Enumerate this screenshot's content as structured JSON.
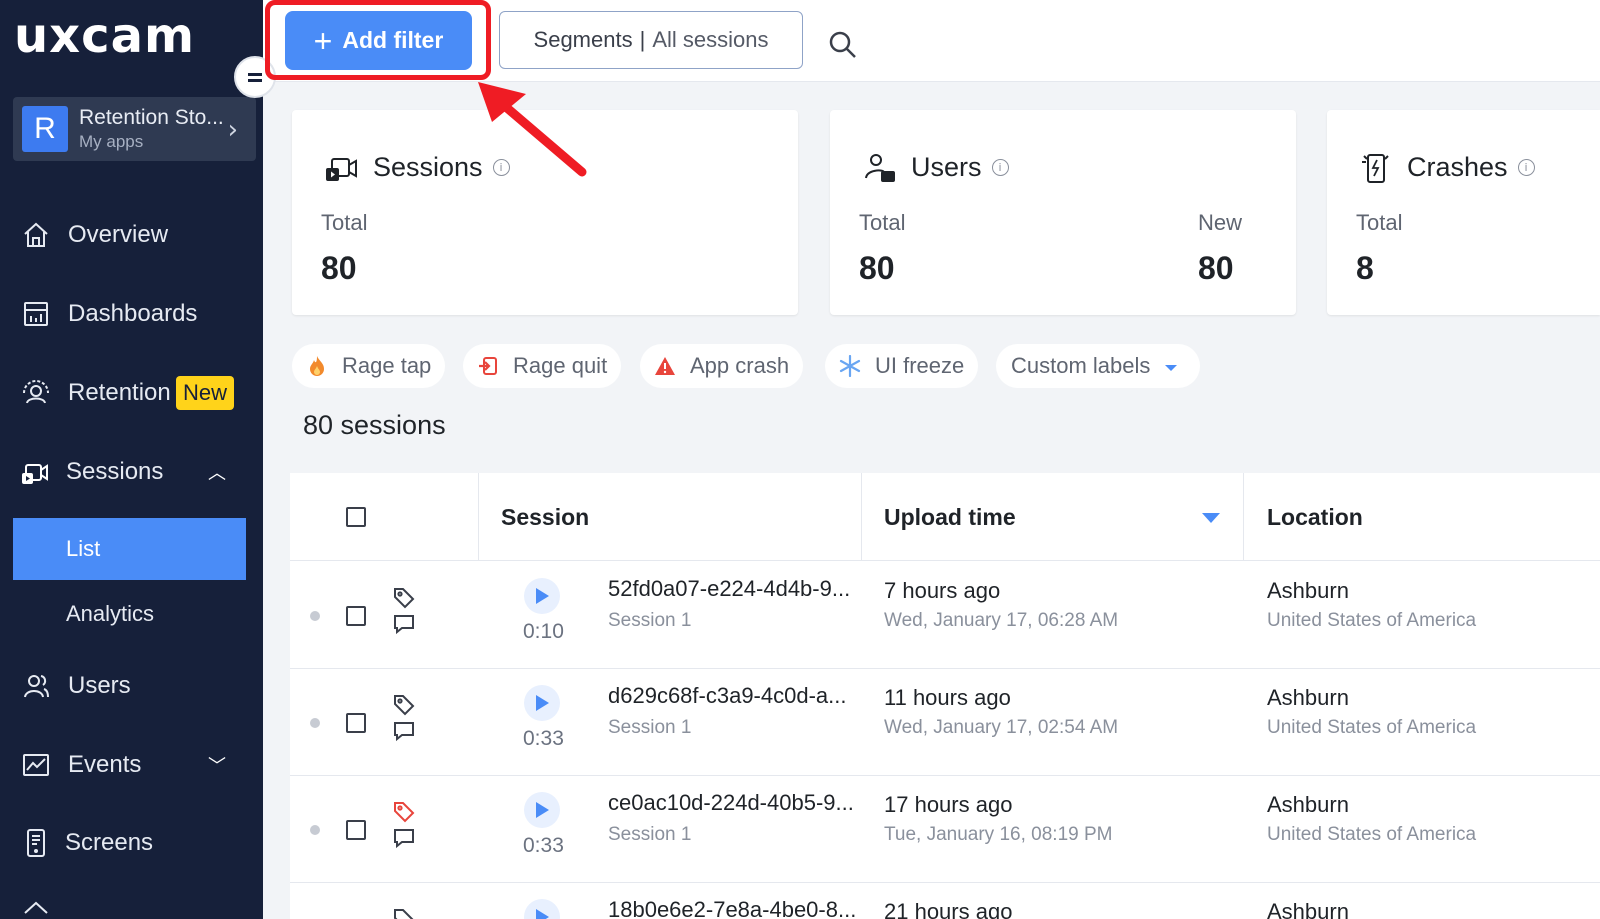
{
  "brand": {
    "logo_text": "uxcam"
  },
  "app_switcher": {
    "avatar_letter": "R",
    "name": "Retention Sto...",
    "subtitle": "My apps"
  },
  "sidebar": {
    "items": [
      {
        "label": "Overview"
      },
      {
        "label": "Dashboards"
      },
      {
        "label": "Retention",
        "badge": "New"
      },
      {
        "label": "Sessions",
        "expanded": true
      },
      {
        "label": "Users"
      },
      {
        "label": "Events"
      },
      {
        "label": "Screens"
      }
    ],
    "sessions_subitems": [
      {
        "label": "List",
        "active": true
      },
      {
        "label": "Analytics"
      }
    ]
  },
  "toolbar": {
    "add_filter_label": "Add filter",
    "segments_label": "Segments",
    "segments_value": "All sessions"
  },
  "metrics": {
    "sessions": {
      "title": "Sessions",
      "total_label": "Total",
      "total_value": "80"
    },
    "users": {
      "title": "Users",
      "total_label": "Total",
      "total_value": "80",
      "new_label": "New",
      "new_value": "80"
    },
    "crashes": {
      "title": "Crashes",
      "total_label": "Total",
      "total_value": "8"
    }
  },
  "quick_filters": [
    {
      "label": "Rage tap",
      "icon": "fire-icon"
    },
    {
      "label": "Rage quit",
      "icon": "exit-icon"
    },
    {
      "label": "App crash",
      "icon": "warning-icon"
    },
    {
      "label": "UI freeze",
      "icon": "snowflake-icon"
    },
    {
      "label": "Custom labels",
      "icon": "caret-down-icon"
    }
  ],
  "session_count_text": "80 sessions",
  "table": {
    "columns": [
      "Session",
      "Upload time",
      "Location"
    ],
    "rows": [
      {
        "duration": "0:10",
        "session_id": "52fd0a07-e224-4d4b-9...",
        "session_name": "Session 1",
        "relative_time": "7 hours ago",
        "upload_time": "Wed, January 17, 06:28 AM",
        "city": "Ashburn",
        "country": "United States of America",
        "tag_color": "#3a3f4a"
      },
      {
        "duration": "0:33",
        "session_id": "d629c68f-c3a9-4c0d-a...",
        "session_name": "Session 1",
        "relative_time": "11 hours ago",
        "upload_time": "Wed, January 17, 02:54 AM",
        "city": "Ashburn",
        "country": "United States of America",
        "tag_color": "#3a3f4a"
      },
      {
        "duration": "0:33",
        "session_id": "ce0ac10d-224d-40b5-9...",
        "session_name": "Session 1",
        "relative_time": "17 hours ago",
        "upload_time": "Tue, January 16, 08:19 PM",
        "city": "Ashburn",
        "country": "United States of America",
        "tag_color": "#e8453c"
      },
      {
        "session_id": "18b0e6e2-7e8a-4be0-8...",
        "relative_time": "21 hours ago",
        "city": "Ashburn"
      }
    ]
  },
  "colors": {
    "sidebar_bg": "#16203a",
    "accent": "#4a8cf7",
    "highlight": "#ef1c24",
    "badge": "#ffd31a"
  }
}
